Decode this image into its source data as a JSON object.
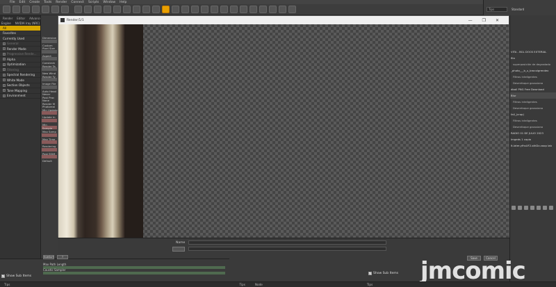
{
  "menu": [
    "File",
    "Edit",
    "Create",
    "Tools",
    "Render",
    "Connect",
    "Scripts",
    "Window",
    "Help"
  ],
  "left_panel": {
    "tabs": [
      "Render",
      "Editor",
      "Advanced"
    ],
    "header": [
      "Engine",
      "NVIDIA Iray (NRC)"
    ],
    "items": [
      {
        "label": "All",
        "active": true
      },
      {
        "label": "Favorites"
      },
      {
        "label": "Currently Used"
      },
      {
        "label": "General",
        "dim": true
      },
      {
        "label": "Render Mode"
      },
      {
        "label": "Progressive Rende...",
        "dim": true
      },
      {
        "label": "Alpha"
      },
      {
        "label": "Optimization"
      },
      {
        "label": "Filtering",
        "dim": true
      },
      {
        "label": "Spectral Rendering"
      },
      {
        "label": "White Mode"
      },
      {
        "label": "Section Objects"
      },
      {
        "label": "Tone Mapping"
      },
      {
        "label": "Environment"
      }
    ]
  },
  "prop_col": {
    "labels": [
      "Dimension",
      "Custom",
      "Pixel Size",
      "Aspect",
      "Constrain",
      "Render Ta",
      "New Wind",
      "Render Ty",
      "Image File",
      "Auto Head",
      "Never",
      "Post Proc",
      "None",
      "Render M",
      "Photoreal",
      "Min Update",
      "Update In",
      "Min Sample",
      "Max Samp",
      "Max Time",
      "Rendering",
      "Post SSIM",
      "Default"
    ]
  },
  "render_window": {
    "title": "Render/1/1",
    "controls": [
      "—",
      "❐",
      "✕"
    ]
  },
  "viewport_bar": {
    "name_label": "Name"
  },
  "bottom_left": {
    "buttons": [
      "SubSurf",
      "?"
    ],
    "label1": "Max Path Length",
    "label2": "Caustic Sampler",
    "show_sub_items": "Show Sub Items"
  },
  "bottom_right": {
    "save": "Save",
    "cancel": "Cancel",
    "show_sub_items": "Show Sub Items"
  },
  "statusbar": {
    "tips": "Tips",
    "tips2": "Tips",
    "node": "Node",
    "tips3": "Tips"
  },
  "right_top": {
    "search": "Tips",
    "std": "Standard",
    "refresh": "Refresh"
  },
  "layers": {
    "rows": [
      {
        "text": "VITA - BGL DOCK EXTERIAL",
        "sel": false
      },
      {
        "text": "fila",
        "sub": false
      },
      {
        "text": "superposición de degradado",
        "sub": true
      },
      {
        "text": "_photo___b_u_brocolgrendex",
        "sub": false
      },
      {
        "text": "Filtros inteligentes",
        "sub": true
      },
      {
        "text": "Desenfoque gaussiano",
        "sub": true
      },
      {
        "text": "dball PNG Free Download",
        "sub": false
      },
      {
        "text": "Blur",
        "sel": true
      },
      {
        "text": "Filtros inteligentes",
        "sub": true
      },
      {
        "text": "Desenfoque gaussiano",
        "sub": true
      },
      {
        "text": "fall_(crop)",
        "sub": false
      },
      {
        "text": "Filtros inteligentes",
        "sub": true
      },
      {
        "text": "Desenfoque gaussiano",
        "sub": true
      },
      {
        "text": "RADIO 01 DE JULIO 2023",
        "sub": false
      },
      {
        "text": "Imgeds 1 copia",
        "sub": false
      },
      {
        "text": "It-later-yfhsUF2-sthDz-voop lab",
        "sub": false
      }
    ]
  },
  "watermark": "jmcomic"
}
